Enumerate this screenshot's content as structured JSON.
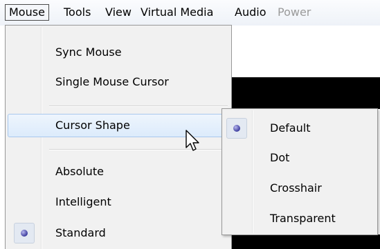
{
  "menubar": {
    "items": [
      {
        "label": "Mouse"
      },
      {
        "label": "Tools"
      },
      {
        "label": "View"
      },
      {
        "label": "Virtual Media"
      },
      {
        "label": "Audio"
      },
      {
        "label": "Power"
      }
    ]
  },
  "mouse_menu": {
    "items": [
      {
        "label": "Sync Mouse"
      },
      {
        "label": "Single Mouse Cursor"
      },
      {
        "label": "Cursor Shape"
      },
      {
        "label": "Absolute"
      },
      {
        "label": "Intelligent"
      },
      {
        "label": "Standard"
      }
    ],
    "checked_item": "Standard",
    "highlighted_item": "Cursor Shape"
  },
  "cursor_shape_submenu": {
    "items": [
      {
        "label": "Default"
      },
      {
        "label": "Dot"
      },
      {
        "label": "Crosshair"
      },
      {
        "label": "Transparent"
      }
    ],
    "checked_item": "Default"
  },
  "icons": {
    "submenu_arrow": "chevron-right-icon",
    "radio_mark": "radio-dot-icon",
    "pointer": "mouse-pointer-icon"
  },
  "colors": {
    "highlight_border": "#a8c8ee",
    "highlight_fill": "#dcebfb",
    "menu_background": "#f1f1f1",
    "radio_dot": "#3c3c9e"
  }
}
